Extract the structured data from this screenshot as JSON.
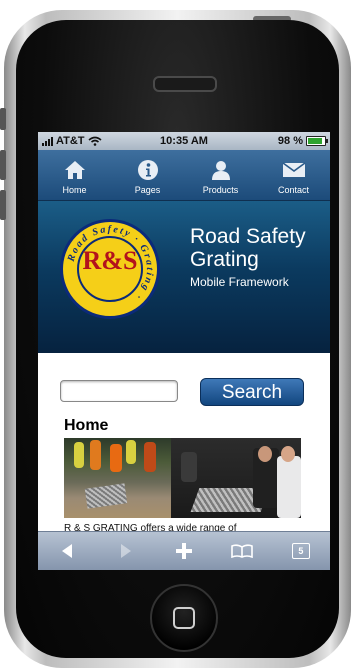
{
  "status_bar": {
    "carrier": "AT&T",
    "time": "10:35 AM",
    "battery": "98 %"
  },
  "nav": [
    {
      "label": "Home",
      "icon": "home-icon"
    },
    {
      "label": "Pages",
      "icon": "info-icon"
    },
    {
      "label": "Products",
      "icon": "person-icon"
    },
    {
      "label": "Contact",
      "icon": "mail-icon"
    }
  ],
  "banner": {
    "logo": {
      "initials": "R&S",
      "ring_text": "Road Safety Grating",
      "since": "Since 1974"
    },
    "title": "Road Safety Grating",
    "subtitle": "Mobile Framework"
  },
  "search": {
    "value": "",
    "button_label": "Search"
  },
  "page": {
    "title": "Home",
    "text": "R & S GRATING offers a wide range of"
  },
  "toolbar": {
    "back_icon": "back-arrow-icon",
    "forward_icon": "forward-arrow-icon",
    "add_icon": "plus-icon",
    "bookmarks_icon": "bookmarks-icon",
    "pages_icon": "pages-icon",
    "pages_count": "5"
  },
  "colors": {
    "nav_blue": "#1c4b7a",
    "logo_yellow": "#f5cf18",
    "logo_red": "#b3121c",
    "battery_green": "#2ea32e"
  }
}
